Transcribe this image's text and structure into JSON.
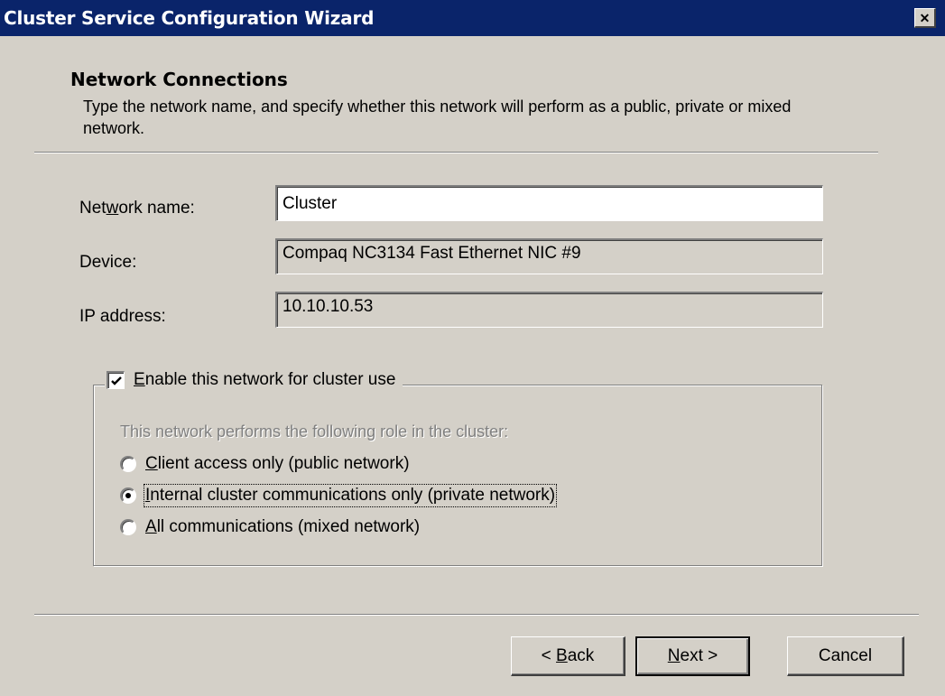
{
  "window": {
    "title": "Cluster Service Configuration Wizard",
    "close_glyph": "✕"
  },
  "header": {
    "title": "Network Connections",
    "description": "Type the network name, and specify whether this network will perform as a public, private or mixed network."
  },
  "fields": {
    "network_name": {
      "label_pre": "Net",
      "label_accel": "w",
      "label_post": "ork name:",
      "value": "Cluster"
    },
    "device": {
      "label": "Device:",
      "value": "Compaq NC3134 Fast Ethernet NIC #9"
    },
    "ip_address": {
      "label": "IP address:",
      "value": "10.10.10.53"
    }
  },
  "cluster_group": {
    "checkbox_checked": true,
    "checkbox_accel": "E",
    "checkbox_rest": "nable this network for cluster use",
    "role_caption": "This network performs the following role in the cluster:",
    "options": [
      {
        "accel": "C",
        "rest": "lient access only (public network)",
        "selected": false
      },
      {
        "accel": "I",
        "rest": "nternal cluster communications only (private network)",
        "selected": true
      },
      {
        "accel": "A",
        "rest": "ll communications (mixed network)",
        "selected": false
      }
    ]
  },
  "buttons": {
    "back": {
      "pre": "< ",
      "accel": "B",
      "post": "ack"
    },
    "next": {
      "pre": "",
      "accel": "N",
      "post": "ext >"
    },
    "cancel": "Cancel"
  }
}
